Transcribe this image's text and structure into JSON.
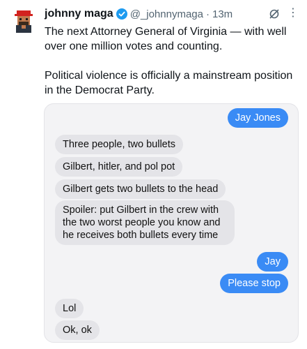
{
  "tweet": {
    "display_name": "johnny maga",
    "handle": "@_johnnymaga",
    "separator": "·",
    "time": "13m",
    "more_icon": "more-dots-icon",
    "grok_icon": "grok-icon",
    "paragraphs": [
      "The next Attorney General of Virginia — with well over one million votes and counting.",
      "Political violence is officially a mainstream position in the Democrat Party."
    ]
  },
  "chat": {
    "messages": [
      {
        "side": "out",
        "text": "Jay Jones"
      },
      {
        "side": "in",
        "text": "Three people, two bullets"
      },
      {
        "side": "in",
        "text": "Gilbert, hitler, and pol pot"
      },
      {
        "side": "in",
        "text": "Gilbert gets two bullets to the head"
      },
      {
        "side": "in",
        "text": "Spoiler: put Gilbert in the crew with the two worst people you know and he receives both bullets every time"
      },
      {
        "side": "out",
        "text": "Jay"
      },
      {
        "side": "out",
        "text": "Please stop"
      },
      {
        "side": "in",
        "text": "Lol"
      },
      {
        "side": "in",
        "text": "Ok, ok"
      }
    ]
  },
  "colors": {
    "text": "#0f1419",
    "muted": "#536471",
    "verified": "#1d9bf0",
    "bubble_out": "#3a8bf5",
    "bubble_in": "#e4e4e8"
  }
}
